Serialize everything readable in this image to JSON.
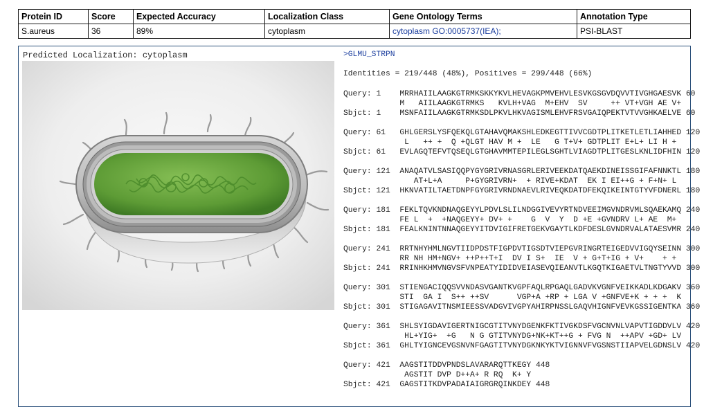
{
  "table": {
    "headers": [
      "Protein ID",
      "Score",
      "Expected Accuracy",
      "Localization Class",
      "Gene Ontology Terms",
      "Annotation Type"
    ],
    "row": {
      "protein_id": "S.aureus",
      "score": "36",
      "expected_accuracy": "89%",
      "localization_class": "cytoplasm",
      "go_terms": "cytoplasm GO:0005737(IEA);",
      "annotation_type": "PSI-BLAST"
    }
  },
  "panel": {
    "predicted_label": "Predicted Localization: cytoplasm",
    "image_icon": "bacterium-cell-illustration",
    "sequence_name": ">GLMU_STRPN",
    "identities": "Identities = 219/448 (48%), Positives = 299/448 (66%)"
  },
  "alignment": [
    {
      "query": "Query: 1    MRRHAIILAAGKGTRMKSKKYKVLHEVAGKPMVEHVLESVKGSGVDQVVTIVGHGAESVK 60",
      "match": "            M   AIILAAGKGTRMKS   KVLH+VAG  M+EHV  SV     ++ VT+VGH AE V+",
      "sbjct": "Sbjct: 1    MSNFAIILAAGKGTRMKSDLPKVLHKVAGISMLEHVFRSVGAIQPEKTVTVVGHKAELVE 60"
    },
    {
      "query": "Query: 61   GHLGERSLYSFQEKQLGTAHAVQMAKSHLEDKEGTTIVVCGDTPLITKETLETLIAHHED 120",
      "match": "             L   ++ +  Q +QLGT HAV M +  LE   G T+V+ GDTPLIT E+L+ LI H +",
      "sbjct": "Sbjct: 61   EVLAGQTEFVTQSEQLGTGHAVMMTEPILEGLSGHTLVIAGDTPLITGESLKNLIDFHIN 120"
    },
    {
      "query": "Query: 121  ANAQATVLSASIQQPYGYGRIVRNASGRLERIVEEKDATQAEKDINEISSGIFAFNNKTL 180",
      "match": "               AT+L+A     P+GYGRIVRN+  + RIVE+KDAT  EK I EI++G + F+N+ L",
      "sbjct": "Sbjct: 121  HKNVATILTAETDNPFGYGRIVRNDNAEVLRIVEQKDATDFEKQIKEINTGTYVFDNERL 180"
    },
    {
      "query": "Query: 181  FEKLTQVKNDNAQGEYYLPDVLSLILNDGGIVEVYRTNDVEEIMGVNDRVMLSQAEKAMQ 240",
      "match": "            FE L  +  +NAQGEYY+ DV+ +    G  V  Y  D +E +GVNDRV L+ AE  M+",
      "sbjct": "Sbjct: 181  FEALKNINTNNAQGEYYITDVIGIFRETGEKVGAYTLKDFDESLGVNDRVALATAESVMR 240"
    },
    {
      "query": "Query: 241  RRTNHYHMLNGVTIIDPDSTFIGPDVTIGSDTVIEPGVRINGRTEIGEDVVIGQYSEINN 300",
      "match": "            RR NH HM+NGV+ ++P++T+I  DV I S+  IE  V + G+T+IG + V+    + +",
      "sbjct": "Sbjct: 241  RRINHKHMVNGVSFVNPEATYIDIDVEIASEVQIEANVTLKGQTKIGAETVLTNGTYVVD 300"
    },
    {
      "query": "Query: 301  STIENGACIQQSVVNDASVGANTKVGPFAQLRPGAQLGADVKVGNFVEIKKADLKDGAKV 360",
      "match": "            STI  GA I  S++ ++SV      VGP+A +RP + LGA V +GNFVE+K + + +  K",
      "sbjct": "Sbjct: 301  STIGAGAVITNSMIEESSVADGVIVGPYAHIRPNSSLGAQVHIGNFVEVKGSSIGENTKA 360"
    },
    {
      "query": "Query: 361  SHLSYIGDAVIGERTNIGCGTITVNYDGENKFKTIVGKDSFVGCNVNLVAPVTIGDDVLV 420",
      "match": "             HL+YIG+  +G   N G GTITVNYDG+NK+KT++G + FVG N  ++APV +GD+ LV",
      "sbjct": "Sbjct: 361  GHLTYIGNCEVGSNVNFGAGTITVNYDGKNKYKTVIGNNVFVGSNSTIIAPVELGDNSLV 420"
    },
    {
      "query": "Query: 421  AAGSTITDDVPNDSLAVARARQTTKEGY 448",
      "match": "             AGSTIT DVP D++A+ R RQ  K+ Y",
      "sbjct": "Sbjct: 421  GAGSTITKDVPADAIAIGRGRQINKDEY 448"
    }
  ]
}
